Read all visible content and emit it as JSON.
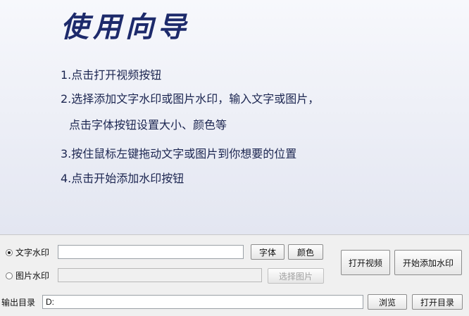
{
  "guide": {
    "title": "使用向导",
    "steps": [
      "1.点击打开视频按钮",
      "2.选择添加文字水印或图片水印，输入文字或图片，",
      "点击字体按钮设置大小、颜色等",
      "3.按住鼠标左键拖动文字或图片到你想要的位置",
      "4.点击开始添加水印按钮"
    ]
  },
  "watermark": {
    "text_option": {
      "label": "文字水印",
      "selected": true,
      "value": ""
    },
    "image_option": {
      "label": "图片水印",
      "selected": false,
      "value": ""
    },
    "font_button": "字体",
    "color_button": "颜色",
    "select_image_button": "选择图片"
  },
  "actions": {
    "open_video": "打开视频",
    "start_watermark": "开始添加水印"
  },
  "output": {
    "label": "输出目录",
    "path": "D:",
    "browse_button": "浏览",
    "open_dir_button": "打开目录"
  }
}
